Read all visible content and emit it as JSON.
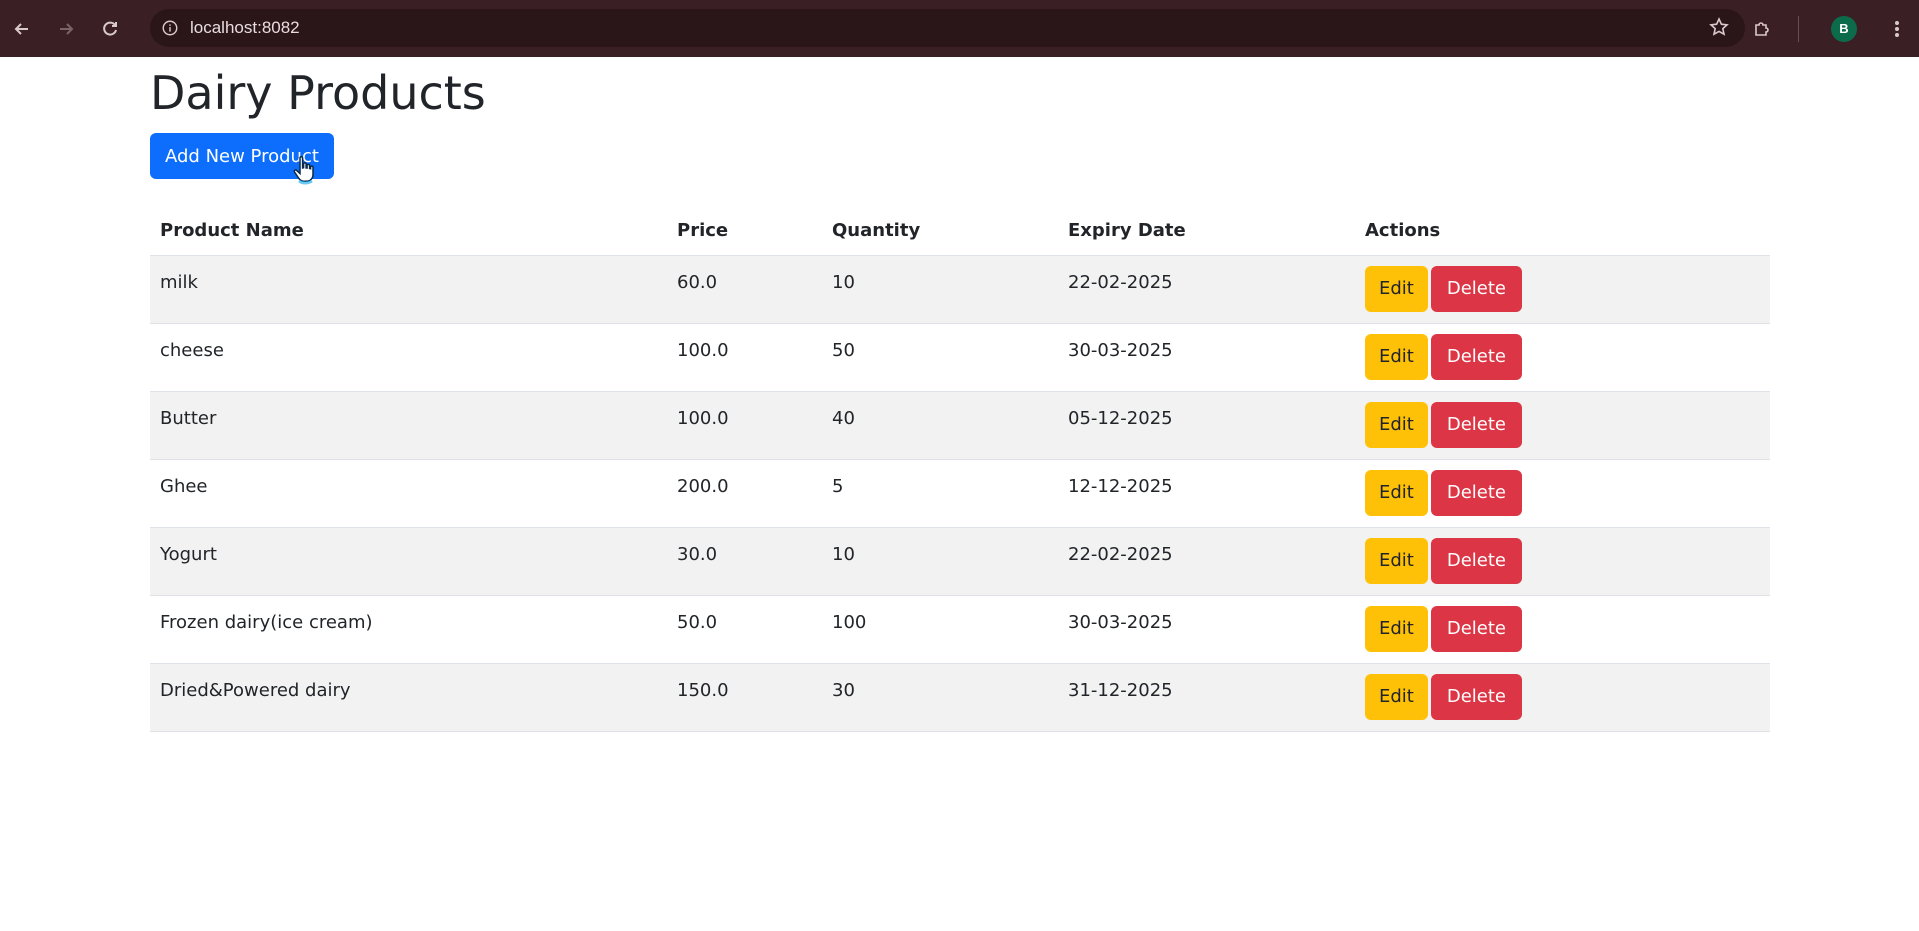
{
  "browser": {
    "url": "localhost:8082",
    "profile_initial": "B"
  },
  "page": {
    "title": "Dairy Products",
    "add_button": "Add New Product"
  },
  "table": {
    "headers": [
      "Product Name",
      "Price",
      "Quantity",
      "Expiry Date",
      "Actions"
    ],
    "rows": [
      {
        "name": "milk",
        "price": "60.0",
        "quantity": "10",
        "expiry": "22-02-2025"
      },
      {
        "name": "cheese",
        "price": "100.0",
        "quantity": "50",
        "expiry": "30-03-2025"
      },
      {
        "name": "Butter",
        "price": "100.0",
        "quantity": "40",
        "expiry": "05-12-2025"
      },
      {
        "name": "Ghee",
        "price": "200.0",
        "quantity": "5",
        "expiry": "12-12-2025"
      },
      {
        "name": "Yogurt",
        "price": "30.0",
        "quantity": "10",
        "expiry": "22-02-2025"
      },
      {
        "name": "Frozen dairy(ice cream)",
        "price": "50.0",
        "quantity": "100",
        "expiry": "30-03-2025"
      },
      {
        "name": "Dried&Powered dairy",
        "price": "150.0",
        "quantity": "30",
        "expiry": "31-12-2025"
      }
    ],
    "edit_label": "Edit",
    "delete_label": "Delete"
  },
  "colors": {
    "primary": "#0d6efd",
    "warning": "#ffc107",
    "danger": "#dc3545",
    "chrome": "#3a1f24"
  }
}
